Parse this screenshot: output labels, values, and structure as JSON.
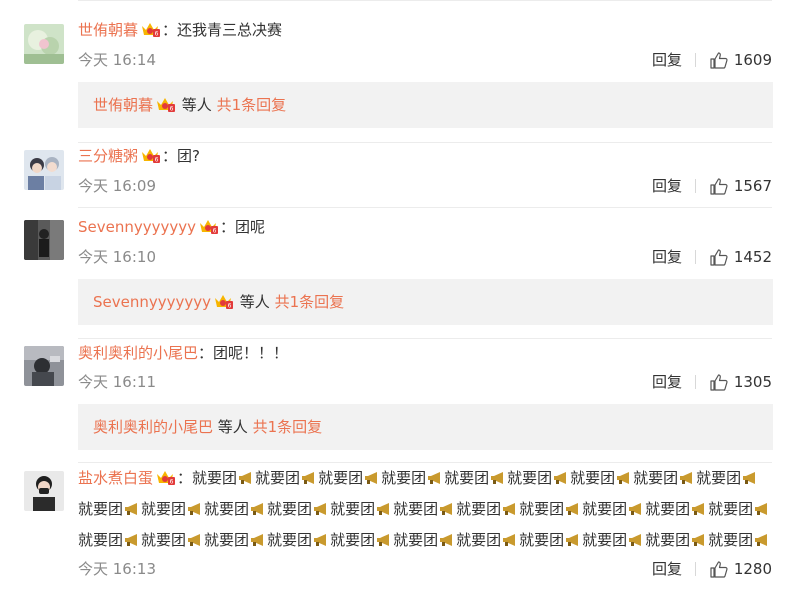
{
  "comments": [
    {
      "user": "世侑朝暮",
      "sep": "：",
      "text": "还我青三总决赛",
      "time": "今天 16:14",
      "reply_label": "回复",
      "likes": "1609",
      "sub": {
        "user": "世侑朝暮",
        "mid": " 等人 ",
        "count": "共1条回复"
      }
    },
    {
      "user": "三分糖粥",
      "sep": "：",
      "text": "团?",
      "time": "今天 16:09",
      "reply_label": "回复",
      "likes": "1567"
    },
    {
      "user": "Sevennyyyyyyy",
      "sep": "：",
      "text": "团呢",
      "time": "今天 16:10",
      "reply_label": "回复",
      "likes": "1452",
      "sub": {
        "user": "Sevennyyyyyyy",
        "mid": " 等人 ",
        "count": "共1条回复"
      }
    },
    {
      "user": "奥利奥利的小尾巴",
      "sep": "：",
      "text": "团呢！！！",
      "time": "今天 16:11",
      "reply_label": "回复",
      "likes": "1305",
      "sub": {
        "user": "奥利奥利的小尾巴",
        "mid": " 等人 ",
        "count": "共1条回复"
      }
    },
    {
      "user": "盐水煮白蛋",
      "sep": "：",
      "text_segments": [
        "就要团",
        "就要团",
        "就要团",
        "就要团",
        "就要团",
        "就要团",
        "就要团",
        "就要团",
        "就要团",
        "就要团",
        "就要团",
        "就要团",
        "就要团",
        "就要团",
        "就要团",
        "就要团",
        "就要团",
        "就要团",
        "就要团",
        "就要团",
        "就要团",
        "就要团",
        "就要团",
        "就要团",
        "就要团",
        "就要团",
        "就要团",
        "就要团",
        "就要团",
        "就要团",
        "就要团"
      ],
      "time": "今天 16:13",
      "reply_label": "回复",
      "likes": "1280"
    }
  ],
  "icons": {
    "vip": "vip-crown-icon",
    "like": "thumbs-up-icon",
    "emoji": "loudspeaker-icon"
  },
  "colors": {
    "username": "#eb7350",
    "meta": "#8a8a8a",
    "subbox": "#f2f2f2",
    "divider": "#ececec"
  }
}
